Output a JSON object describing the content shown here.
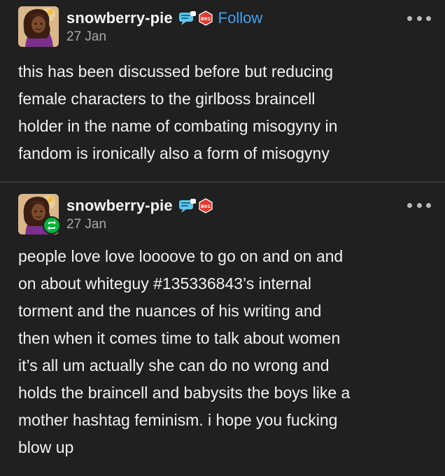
{
  "posts": [
    {
      "username": "snowberry-pie",
      "follow_label": "Follow",
      "date": "27 Jan",
      "badge_text": "B01",
      "avatar_icon": "avatar-illustration",
      "more_icon": "ellipsis-icon",
      "lines": [
        "this has been discussed before but reducing",
        "female characters to the girlboss braincell",
        "holder in the name of combating misogyny in",
        "fandom is ironically also a form of misogyny"
      ]
    },
    {
      "username": "snowberry-pie",
      "date": "27 Jan",
      "badge_text": "B01",
      "avatar_icon": "avatar-illustration",
      "reblog_icon": "reblog-icon",
      "more_icon": "ellipsis-icon",
      "lines": [
        "people love love loooove to go on and on and",
        "on about whiteguy #135336843’s internal",
        "torment and the nuances of his writing and",
        "then when it comes time to talk about women",
        "it’s all um actually she can do no wrong and",
        "holds the braincell and babysits the boys like a",
        "mother hashtag feminism. i hope you fucking",
        "blow up"
      ]
    }
  ],
  "colors": {
    "background": "#202020",
    "text": "#f2f2f2",
    "muted": "#a8a8a8",
    "link": "#3fa2f2",
    "reblog_green": "#00b43a",
    "badge_red": "#e23b2e"
  }
}
